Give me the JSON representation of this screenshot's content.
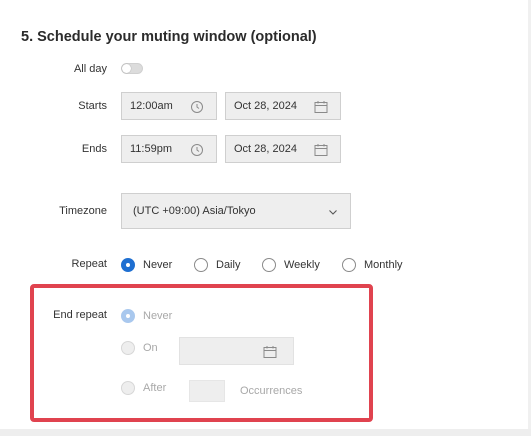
{
  "section": {
    "title": "5. Schedule your muting window (optional)"
  },
  "all_day": {
    "label": "All day",
    "enabled": false
  },
  "starts": {
    "label": "Starts",
    "time": "12:00am",
    "date": "Oct 28, 2024"
  },
  "ends": {
    "label": "Ends",
    "time": "11:59pm",
    "date": "Oct 28, 2024"
  },
  "timezone": {
    "label": "Timezone",
    "value": "(UTC +09:00) Asia/Tokyo"
  },
  "repeat": {
    "label": "Repeat",
    "selected": "Never",
    "options": [
      "Never",
      "Daily",
      "Weekly",
      "Monthly"
    ]
  },
  "end_repeat": {
    "label": "End repeat",
    "never_label": "Never",
    "on_label": "On",
    "after_label": "After",
    "occurrences_label": "Occurrences",
    "selected": "Never"
  },
  "colors": {
    "accent": "#1f6fd1",
    "highlight": "#e0434f",
    "field_bg": "#eeeeee"
  }
}
